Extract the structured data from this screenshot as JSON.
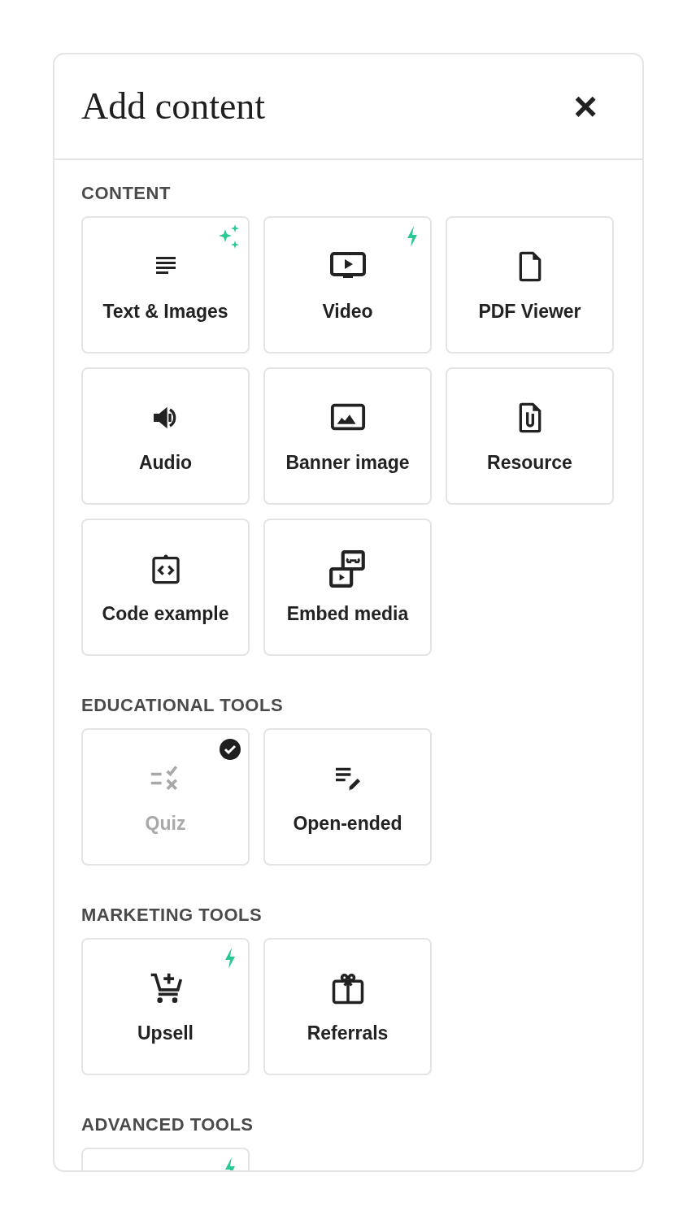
{
  "dialog": {
    "title": "Add content",
    "close": "×"
  },
  "sections": [
    {
      "title": "CONTENT",
      "items": [
        {
          "kind": "text",
          "label": "Text & Images",
          "sparkle": true,
          "bolt": false,
          "added": false,
          "disabled": false
        },
        {
          "kind": "video",
          "label": "Video",
          "sparkle": false,
          "bolt": true,
          "added": false,
          "disabled": false
        },
        {
          "kind": "pdf",
          "label": "PDF Viewer",
          "sparkle": false,
          "bolt": false,
          "added": false,
          "disabled": false
        },
        {
          "kind": "audio",
          "label": "Audio",
          "sparkle": false,
          "bolt": false,
          "added": false,
          "disabled": false
        },
        {
          "kind": "banner",
          "label": "Banner image",
          "sparkle": false,
          "bolt": false,
          "added": false,
          "disabled": false
        },
        {
          "kind": "resource",
          "label": "Resource",
          "sparkle": false,
          "bolt": false,
          "added": false,
          "disabled": false
        },
        {
          "kind": "code",
          "label": "Code example",
          "sparkle": false,
          "bolt": false,
          "added": false,
          "disabled": false
        },
        {
          "kind": "embed",
          "label": "Embed media",
          "sparkle": false,
          "bolt": false,
          "added": false,
          "disabled": false
        }
      ]
    },
    {
      "title": "EDUCATIONAL TOOLS",
      "items": [
        {
          "kind": "quiz",
          "label": "Quiz",
          "sparkle": false,
          "bolt": false,
          "added": true,
          "disabled": true
        },
        {
          "kind": "open",
          "label": "Open-ended",
          "sparkle": false,
          "bolt": false,
          "added": false,
          "disabled": false
        }
      ]
    },
    {
      "title": "MARKETING TOOLS",
      "items": [
        {
          "kind": "upsell",
          "label": "Upsell",
          "sparkle": false,
          "bolt": true,
          "added": false,
          "disabled": false
        },
        {
          "kind": "referrals",
          "label": "Referrals",
          "sparkle": false,
          "bolt": false,
          "added": false,
          "disabled": false
        }
      ]
    },
    {
      "title": "ADVANCED TOOLS",
      "items": [
        {
          "kind": "blank",
          "sparkle": false,
          "bolt": true,
          "added": false,
          "disabled": false
        }
      ]
    }
  ]
}
